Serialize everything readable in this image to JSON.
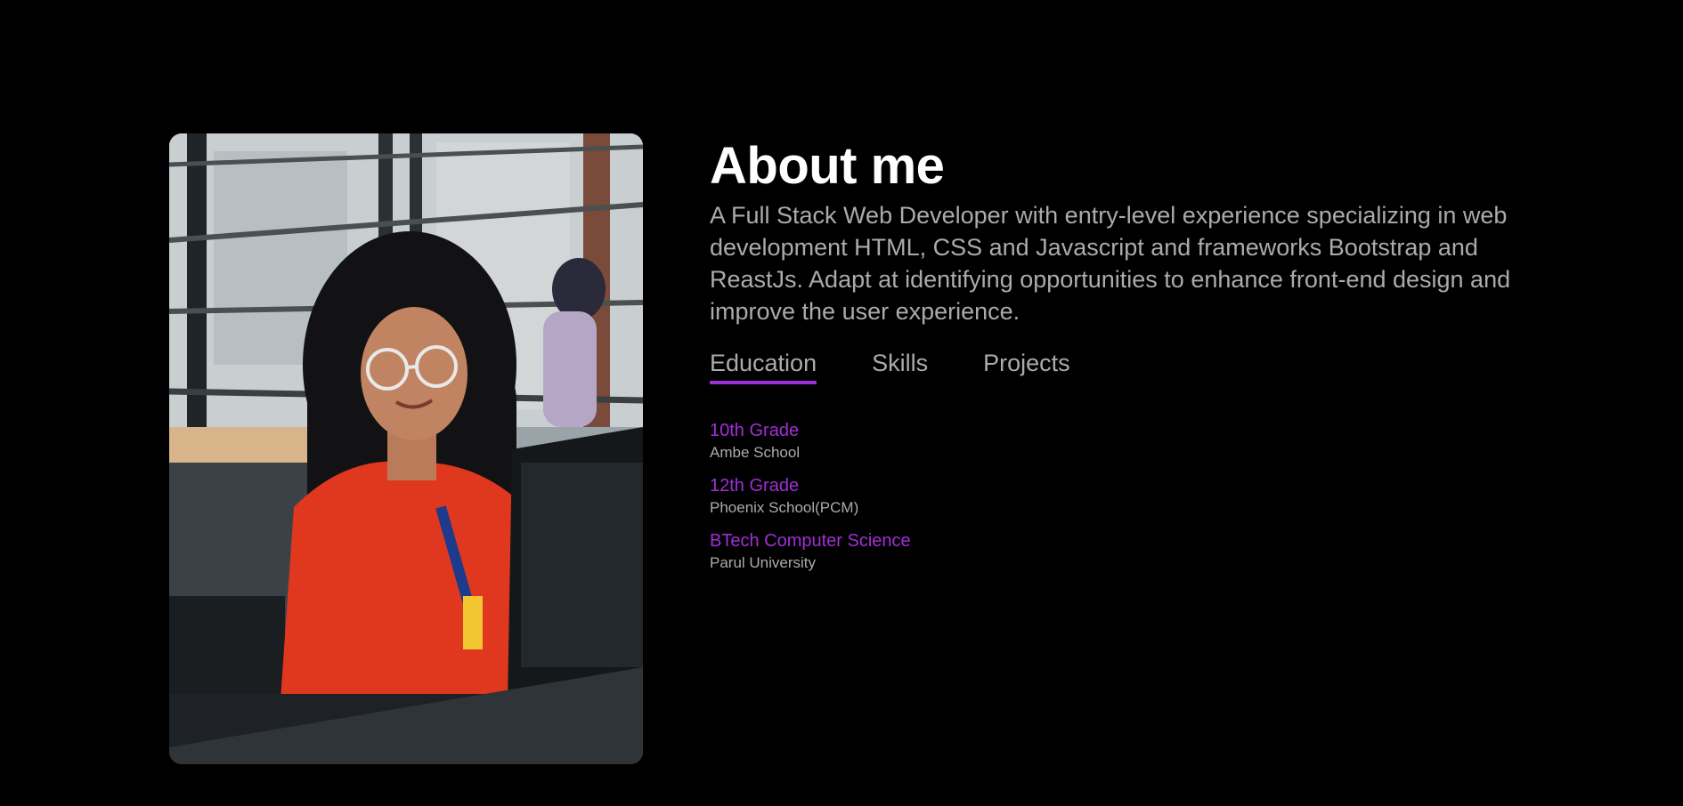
{
  "about": {
    "title": "About me",
    "description": "A Full Stack Web Developer with entry-level experience specializing in web development HTML, CSS and Javascript and frameworks Bootstrap and ReastJs. Adapt at identifying opportunities to enhance front-end design and improve the user experience."
  },
  "tabs": [
    {
      "label": "Education",
      "active": true
    },
    {
      "label": "Skills",
      "active": false
    },
    {
      "label": "Projects",
      "active": false
    }
  ],
  "education": [
    {
      "degree": "10th Grade",
      "school": "Ambe School"
    },
    {
      "degree": "12th Grade",
      "school": "Phoenix School(PCM)"
    },
    {
      "degree": "BTech Computer Science",
      "school": "Parul University"
    }
  ],
  "colors": {
    "background": "#000000",
    "accent": "#a12fd6",
    "heading": "#ffffff",
    "body_text": "#ababab"
  }
}
